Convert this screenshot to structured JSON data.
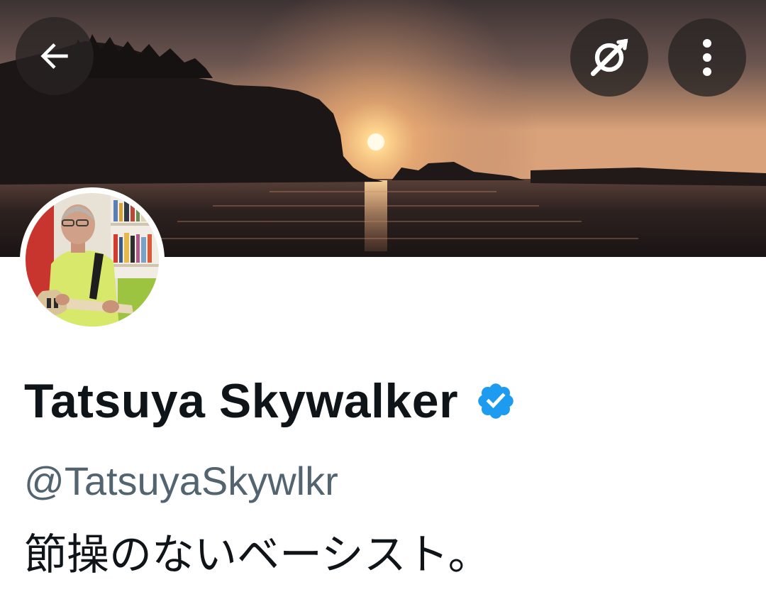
{
  "header": {
    "back_icon": "arrow-left-icon",
    "grok_icon": "grok-icon",
    "more_icon": "more-vertical-icon"
  },
  "banner": {
    "description_icon": "sunset-banner-image"
  },
  "profile": {
    "display_name": "Tatsuya Skywalker",
    "verified": true,
    "handle": "@TatsuyaSkywlkr",
    "bio": "節操のないベーシスト。"
  },
  "colors": {
    "verified_blue": "#1d9bf0",
    "primary_text": "#0f1419",
    "secondary_text": "#536471"
  }
}
